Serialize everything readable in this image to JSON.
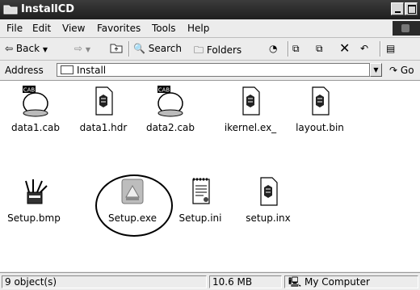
{
  "window": {
    "title": "InstallCD"
  },
  "menu": [
    "File",
    "Edit",
    "View",
    "Favorites",
    "Tools",
    "Help"
  ],
  "toolbar": {
    "back": "Back",
    "search": "Search",
    "folders": "Folders"
  },
  "address": {
    "label": "Address",
    "value": "Install",
    "go": "Go"
  },
  "files": [
    {
      "name": "data1.cab",
      "icon": "cab-icon"
    },
    {
      "name": "data1.hdr",
      "icon": "document-icon"
    },
    {
      "name": "data2.cab",
      "icon": "cab-icon"
    },
    {
      "name": "ikernel.ex_",
      "icon": "document-icon"
    },
    {
      "name": "layout.bin",
      "icon": "document-icon"
    },
    {
      "name": "Setup.bmp",
      "icon": "paint-icon"
    },
    {
      "name": "Setup.exe",
      "icon": "installer-icon"
    },
    {
      "name": "Setup.ini",
      "icon": "notepad-icon"
    },
    {
      "name": "setup.inx",
      "icon": "document-icon"
    }
  ],
  "status": {
    "objects": "9 object(s)",
    "size": "10.6 MB",
    "zone": "My Computer"
  }
}
